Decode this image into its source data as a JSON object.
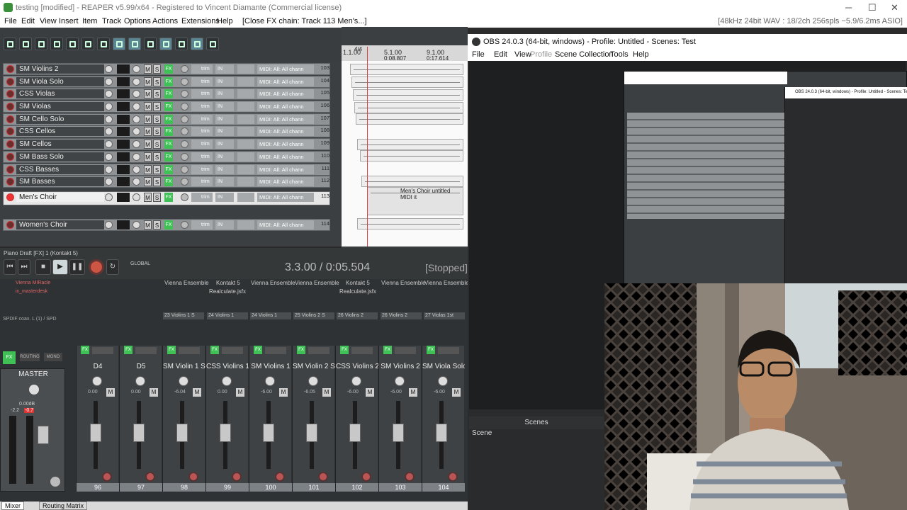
{
  "reaper": {
    "window_title": "testing [modified] - REAPER v5.99/x64 - Registered to Vincent Diamante (Commercial license)",
    "menu": [
      "File",
      "Edit",
      "View",
      "Insert",
      "Item",
      "Track",
      "Options",
      "Actions",
      "Extensions",
      "Help",
      "[Close FX chain: Track 113 Men's...]"
    ],
    "status_right": "[48kHz 24bit WAV : 18/2ch 256spls ~5.9/6.2ms ASIO]",
    "tracks": [
      {
        "name": "SM Violins 2",
        "midi": "MIDI: All: All chann",
        "num": "103",
        "selected": false,
        "armed": false
      },
      {
        "name": "SM Viola Solo",
        "midi": "MIDI: All: All chann",
        "num": "104",
        "selected": false,
        "armed": false
      },
      {
        "name": "CSS Violas",
        "midi": "MIDI: All: All chann",
        "num": "105",
        "selected": false,
        "armed": false
      },
      {
        "name": "SM Violas",
        "midi": "MIDI: All: All chann",
        "num": "106",
        "selected": false,
        "armed": false
      },
      {
        "name": "SM Cello Solo",
        "midi": "MIDI: All: All chann",
        "num": "107",
        "selected": false,
        "armed": false
      },
      {
        "name": "CSS Cellos",
        "midi": "MIDI: All: All chann",
        "num": "108",
        "selected": false,
        "armed": false
      },
      {
        "name": "SM Cellos",
        "midi": "MIDI: All: All chann",
        "num": "109",
        "selected": false,
        "armed": false
      },
      {
        "name": "SM Bass Solo",
        "midi": "MIDI: All: All chann",
        "num": "110",
        "selected": false,
        "armed": false
      },
      {
        "name": "CSS Basses",
        "midi": "MIDI: All: All chann",
        "num": "111",
        "selected": false,
        "armed": false
      },
      {
        "name": "SM Basses",
        "midi": "MIDI: All: All chann",
        "num": "112",
        "selected": false,
        "armed": false
      },
      {
        "name": "Men's Choir",
        "midi": "MIDI: All: All chann",
        "num": "113",
        "selected": true,
        "armed": true
      },
      {
        "name": "Women's Choir",
        "midi": "MIDI: All: All chann",
        "num": "114",
        "selected": false,
        "armed": false
      }
    ],
    "track_buttons": {
      "m": "M",
      "s": "S",
      "fx": "FX",
      "trim": "trim",
      "in": "IN"
    },
    "ruler": {
      "marker": "4/4",
      "pos1": "1.1.00",
      "pos2": "5.1.00",
      "pos3": "9.1.00",
      "time2": "0:08.807",
      "time3": "0:17.614",
      "label_top": "109"
    },
    "item_label": "Men's Choir untitled MIDI it",
    "transport": {
      "fx_window": "Piano Draft [FX] 1 (Kontakt 5)",
      "global": "GLOBAL",
      "time": "3.3.00 / 0:05.504",
      "state": "[Stopped]"
    },
    "mixer": {
      "master_label": "MASTER",
      "master_db": "0.00dB",
      "master_peak": "-0.7",
      "master_left": "-2.2",
      "routing": "ROUTING",
      "mono": "MONO",
      "plugins": [
        "Vienna MIRacle",
        "Vienna Ensemble",
        "Kontakt 5",
        "Vienna Ensemble",
        "Vienna Ensemble",
        "Kontakt 5",
        "Vienna Ensemble",
        "Vienna Ensemble"
      ],
      "plugins2": [
        "Realculate.jsfx",
        "Realculate.jsfx"
      ],
      "left_labels": [
        "Vienna MIRacle",
        "ix_masterdesk",
        "SPDIF coax. L (1) / SPD"
      ],
      "sends": [
        "23 Violins 1 S",
        "24 Violins 1",
        "24 Violins 1",
        "25 Violins 2 S",
        "26 Violins 2",
        "26 Violins 2",
        "27 Violas 1st"
      ],
      "strips": [
        {
          "name": "D4",
          "num": "96",
          "db": "0.00"
        },
        {
          "name": "D5",
          "num": "97",
          "db": "0.00"
        },
        {
          "name": "SM Violin 1 Sc",
          "num": "98",
          "db": "-6.04"
        },
        {
          "name": "CSS Violins 1",
          "num": "99",
          "db": "0.00"
        },
        {
          "name": "SM Violins 1",
          "num": "100",
          "db": "-6.00"
        },
        {
          "name": "SM Violin 2 Sc",
          "num": "101",
          "db": "-6.05"
        },
        {
          "name": "CSS Violins 2",
          "num": "102",
          "db": "-6.00"
        },
        {
          "name": "SM Violins 2",
          "num": "103",
          "db": "-6.00"
        },
        {
          "name": "SM Viola Solo",
          "num": "104",
          "db": "-6.00"
        }
      ],
      "tabs": [
        "Mixer",
        "Routing Matrix"
      ]
    }
  },
  "obs": {
    "title": "OBS 24.0.3 (64-bit, windows) - Profile: Untitled - Scenes: Test",
    "menu": [
      "File",
      "Edit",
      "View",
      "Profile",
      "Scene Collection",
      "Tools",
      "Help"
    ],
    "scenes_header": "Scenes",
    "scene_item": "Scene",
    "nested_title": "OBS 24.0.3 (64-bit, windows) - Profile: Untitled - Scenes: Test"
  },
  "colors": {
    "accent_green": "#3fc156",
    "record_red": "#e33",
    "selected_track": "#e6e6e6"
  }
}
